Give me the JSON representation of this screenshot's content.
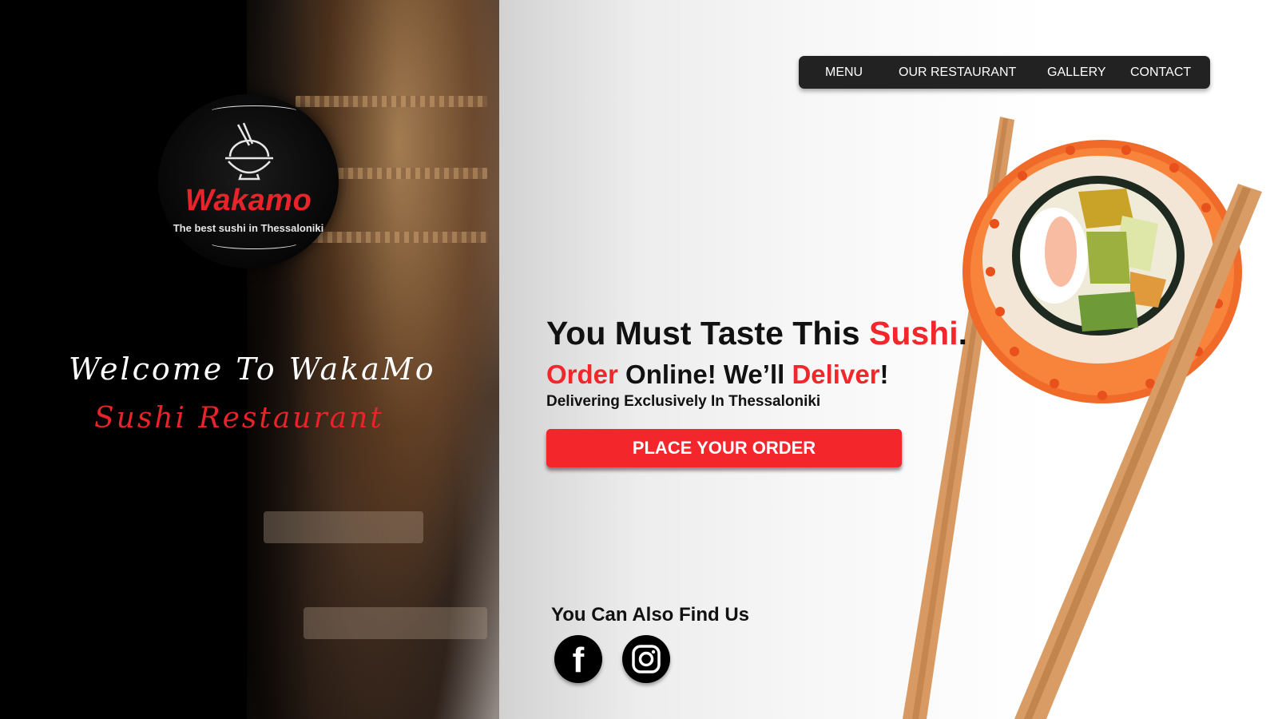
{
  "brand": {
    "name": "Wakamo",
    "tagline": "The best sushi in Thessaloniki"
  },
  "welcome": {
    "line1": "Welcome To WakaMo",
    "line2": "Sushi Restaurant"
  },
  "nav": {
    "items": [
      {
        "label": "MENU"
      },
      {
        "label": "OUR RESTAURANT"
      },
      {
        "label": "GALLERY"
      },
      {
        "label": "CONTACT"
      }
    ]
  },
  "hero": {
    "headline_prefix": "You Must Taste This ",
    "headline_accent": "Sushi",
    "headline_suffix": ".",
    "sub_word1": "Order",
    "sub_middle": " Online! We’ll ",
    "sub_word2": "Deliver",
    "sub_end": "!",
    "tagline": "Delivering Exclusively In Thessaloniki",
    "cta_label": "PLACE YOUR ORDER"
  },
  "social": {
    "heading": "You Can Also Find Us",
    "links": [
      {
        "icon": "facebook-icon"
      },
      {
        "icon": "instagram-icon"
      }
    ]
  },
  "colors": {
    "accent": "#f2262b",
    "nav_bg": "#222222",
    "text": "#111111"
  }
}
